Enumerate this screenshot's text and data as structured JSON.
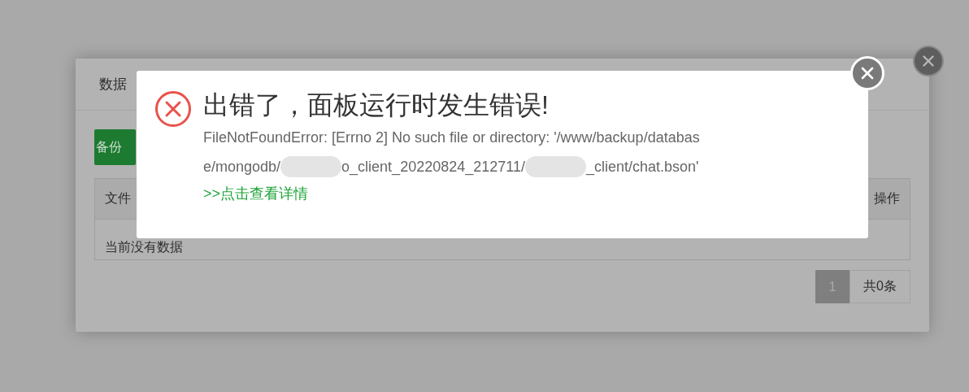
{
  "background_dialog": {
    "title": "数据",
    "buttons": [
      "备份"
    ],
    "table": {
      "columns": [
        "文件",
        "操作"
      ],
      "empty_text": "当前没有数据"
    },
    "pagination": {
      "pages": [
        {
          "label": "1",
          "selected": true
        }
      ],
      "total": "共0条"
    }
  },
  "error_dialog": {
    "title": "出错了，面板运行时发生错误!",
    "message_lines": [
      [
        {
          "kind": "text",
          "text": "FileNotFoundError: [Errno 2] No such file or directory: '/www/backup/databas"
        }
      ],
      [
        {
          "kind": "text",
          "text": "e/mongodb/"
        },
        {
          "kind": "redacted"
        },
        {
          "kind": "text",
          "text": "o_client_20220824_212711/"
        },
        {
          "kind": "redacted"
        },
        {
          "kind": "text",
          "text": "_client/chat.bson'"
        }
      ]
    ],
    "details_link": ">>点击查看详情"
  }
}
